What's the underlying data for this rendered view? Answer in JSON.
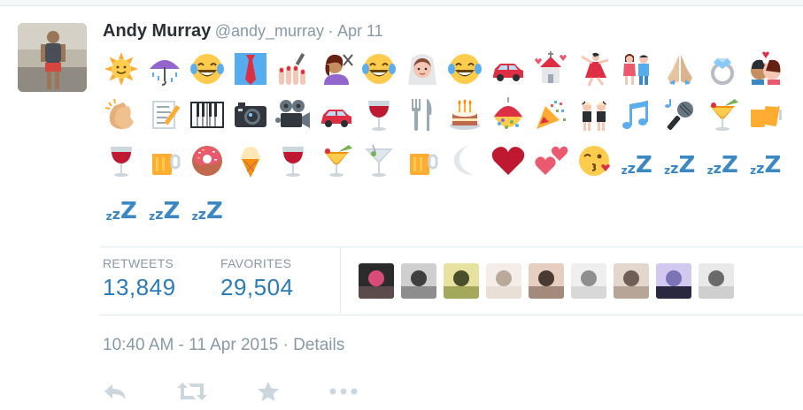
{
  "tweet": {
    "user_name": "Andy Murray",
    "user_handle": "@andy_murray",
    "date_separator": "·",
    "date": "Apr 11",
    "emoji_rows": [
      [
        "sun",
        "umbrella-rain",
        "laughing-tears",
        "necktie",
        "nail-polish",
        "haircut",
        "laughing-tears",
        "bride",
        "laughing-tears",
        "car",
        "wedding-chapel",
        "dancer",
        "couple",
        "praying-hands",
        "ring",
        "kiss"
      ],
      [
        "clapping-hands",
        "memo",
        "piano-keys",
        "camera",
        "movie-camera",
        "car",
        "wine-glass",
        "fork-knife",
        "birthday-cake",
        "confetti-ball",
        "party-popper",
        "dancers",
        "music-notes",
        "microphone",
        "tropical-drink",
        "beers"
      ],
      [
        "wine-glass",
        "beer",
        "doughnut",
        "ice-cream",
        "wine-glass",
        "tropical-drink",
        "cocktail",
        "beer",
        "crescent-moon",
        "red-heart",
        "two-hearts",
        "kissing-face",
        "zzz",
        "zzz",
        "zzz",
        "zzz"
      ],
      [
        "zzz",
        "zzz",
        "zzz"
      ]
    ],
    "stats": {
      "retweets_label": "RETWEETS",
      "retweets_value": "13,849",
      "favorites_label": "FAVORITES",
      "favorites_value": "29,504"
    },
    "favoriter_avatars": [
      "avatar-1",
      "avatar-2",
      "avatar-3",
      "avatar-4",
      "avatar-5",
      "avatar-6",
      "avatar-7",
      "avatar-8",
      "avatar-9"
    ],
    "timestamp": "10:40 AM - 11 Apr 2015",
    "timestamp_separator": "·",
    "details_link": "Details",
    "actions": [
      "reply-icon",
      "retweet-icon",
      "favorite-icon",
      "more-icon"
    ]
  },
  "colors": {
    "link_blue": "#2b7bb9",
    "muted_gray": "#8899a6",
    "action_gray": "#ccd6dd",
    "text_dark": "#292f33"
  }
}
